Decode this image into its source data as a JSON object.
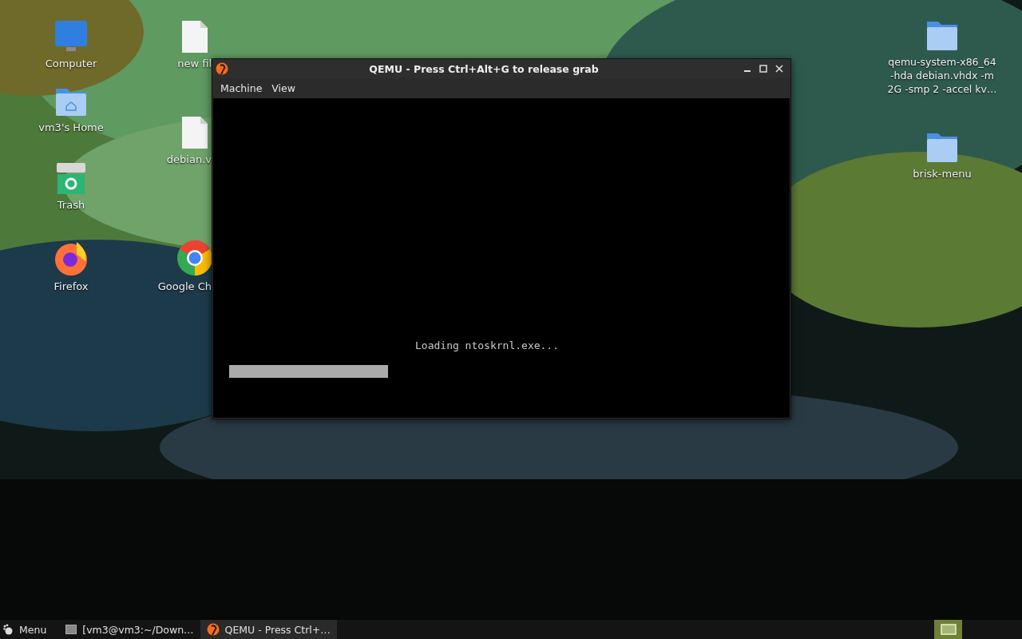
{
  "desktop_icons": [
    {
      "kind": "monitor",
      "label": "Computer"
    },
    {
      "kind": "home-folder",
      "label": "vm3's Home"
    },
    {
      "kind": "trash",
      "label": "Trash"
    },
    {
      "kind": "firefox",
      "label": "Firefox"
    },
    {
      "kind": "file",
      "label": "new fil"
    },
    {
      "kind": "file",
      "label": "debian.v"
    },
    {
      "kind": "chrome",
      "label": "Google Ch"
    },
    {
      "kind": "folder",
      "label": "qemu-system-x86_64 -hda debian.vhdx -m 2G -smp 2 -accel kv…"
    },
    {
      "kind": "folder",
      "label": "brisk-menu"
    }
  ],
  "window": {
    "title": "QEMU - Press Ctrl+Alt+G to release grab",
    "menu": [
      "Machine",
      "View"
    ],
    "screen": {
      "message": "Loading ntoskrnl.exe...",
      "progress": {
        "level": 0.29
      }
    }
  },
  "taskbar": {
    "menu_label": "Menu",
    "tasks": [
      {
        "kind": "terminal",
        "label": "[vm3@vm3:~/Down…",
        "selected": false
      },
      {
        "kind": "qemu",
        "label": "QEMU - Press Ctrl+…",
        "selected": true
      }
    ]
  }
}
